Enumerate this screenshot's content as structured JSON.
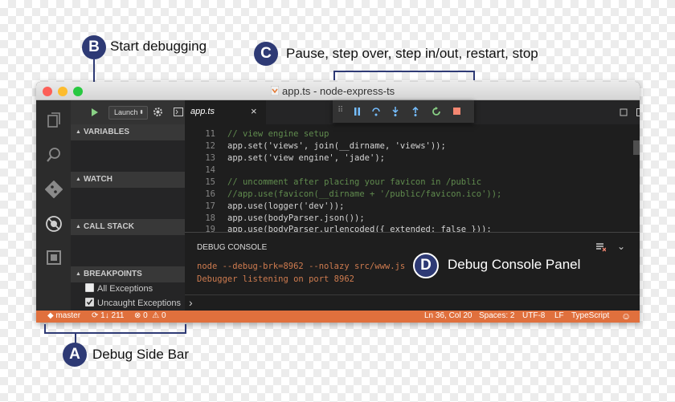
{
  "callouts": {
    "a": {
      "letter": "A",
      "text": "Debug Side Bar"
    },
    "b": {
      "letter": "B",
      "text": "Start debugging"
    },
    "c": {
      "letter": "C",
      "text": "Pause, step over, step in/out, restart, stop"
    },
    "d": {
      "letter": "D",
      "text": "Debug Console Panel"
    }
  },
  "window": {
    "title": "app.ts - node-express-ts"
  },
  "sidebar": {
    "launch_config": "Launch",
    "sections": {
      "variables": "VARIABLES",
      "watch": "WATCH",
      "call_stack": "CALL STACK",
      "breakpoints": "BREAKPOINTS"
    },
    "breakpoints": [
      {
        "label": "All Exceptions",
        "checked": false
      },
      {
        "label": "Uncaught Exceptions",
        "checked": true
      }
    ]
  },
  "tab": {
    "label": "app.ts",
    "close": "×"
  },
  "editor": {
    "lines": [
      {
        "n": "11",
        "text": "// view engine setup"
      },
      {
        "n": "12",
        "text": "app.set('views', join(__dirname, 'views'));"
      },
      {
        "n": "13",
        "text": "app.set('view engine', 'jade');"
      },
      {
        "n": "14",
        "text": ""
      },
      {
        "n": "15",
        "text": "// uncomment after placing your favicon in /public"
      },
      {
        "n": "16",
        "text": "//app.use(favicon(__dirname + '/public/favicon.ico'));"
      },
      {
        "n": "17",
        "text": "app.use(logger('dev'));"
      },
      {
        "n": "18",
        "text": "app.use(bodyParser.json());"
      },
      {
        "n": "19",
        "text": "app.use(bodyParser.urlencoded({ extended: false }));"
      }
    ]
  },
  "panel": {
    "title": "DEBUG CONSOLE",
    "lines": [
      "node --debug-brk=8962 --nolazy src/www.js",
      "Debugger listening on port 8962"
    ],
    "prompt": "›"
  },
  "statusbar": {
    "branch": "master",
    "sync": "1↓ 211",
    "errors": "0",
    "warnings": "0",
    "position": "Ln 36, Col 20",
    "spaces": "Spaces: 2",
    "encoding": "UTF-8",
    "eol": "LF",
    "language": "TypeScript"
  },
  "colors": {
    "accent": "#2e3a75",
    "status": "#e0703d",
    "console": "#ce7b4f"
  }
}
